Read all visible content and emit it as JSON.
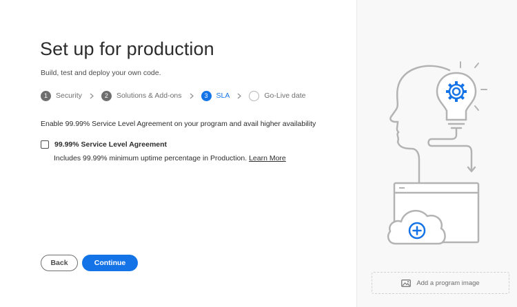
{
  "page": {
    "title": "Set up for production",
    "subtitle": "Build, test and deploy your own code."
  },
  "steps": [
    {
      "number": "1",
      "label": "Security",
      "state": "complete"
    },
    {
      "number": "2",
      "label": "Solutions & Add-ons",
      "state": "complete"
    },
    {
      "number": "3",
      "label": "SLA",
      "state": "active"
    },
    {
      "number": "",
      "label": "Go-Live date",
      "state": "pending"
    }
  ],
  "sla": {
    "intro": "Enable 99.99% Service Level Agreement on your program and avail higher availability",
    "checkbox_label": "99.99% Service Level Agreement",
    "checked": false,
    "description": "Includes 99.99% minimum uptime percentage in Production.",
    "learn_more": "Learn More"
  },
  "actions": {
    "back_label": "Back",
    "continue_label": "Continue"
  },
  "sidebar": {
    "add_image_label": "Add a program image"
  },
  "colors": {
    "accent": "#1473e6",
    "illustration_gray": "#b3b3b3",
    "sidebar_bg": "#f8f8f8"
  }
}
